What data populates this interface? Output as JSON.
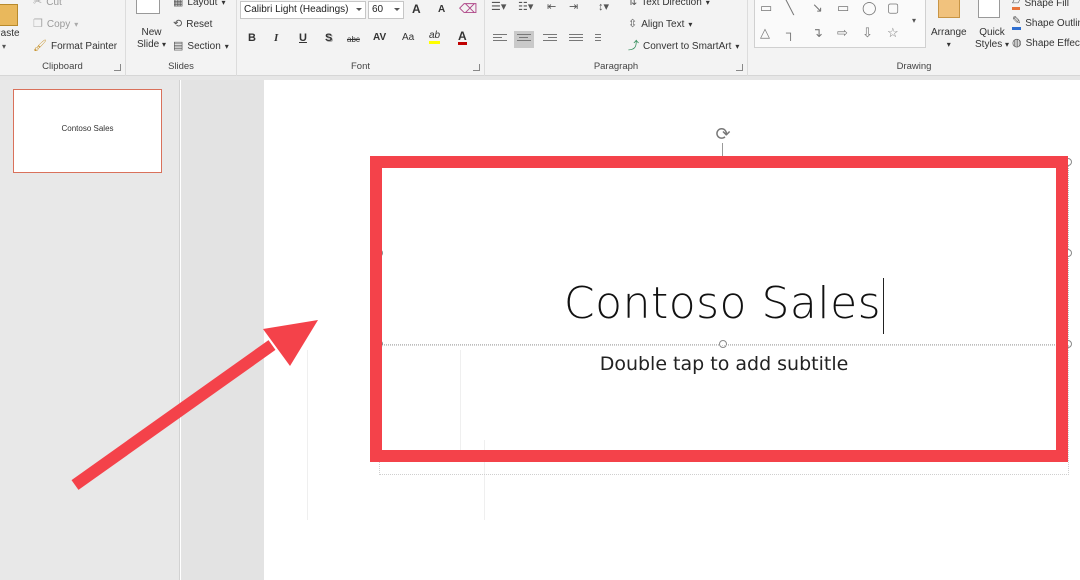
{
  "ribbon": {
    "clipboard": {
      "label": "Clipboard",
      "paste": "Paste",
      "cut": "Cut",
      "copy": "Copy",
      "format_painter": "Format Painter"
    },
    "slides": {
      "label": "Slides",
      "new_slide_line1": "New",
      "new_slide_line2": "Slide",
      "layout": "Layout",
      "reset": "Reset",
      "section": "Section"
    },
    "font": {
      "label": "Font",
      "font_name": "Calibri Light (Headings)",
      "font_size": "60",
      "bold": "B",
      "italic": "I",
      "underline": "U",
      "shadow": "S",
      "strikethrough": "abc",
      "char_spacing": "AV",
      "change_case": "Aa",
      "grow": "A",
      "shrink": "A",
      "highlight": "ab",
      "font_color": "A"
    },
    "paragraph": {
      "label": "Paragraph",
      "text_direction": "Text Direction",
      "align_text": "Align Text",
      "convert_smartart": "Convert to SmartArt"
    },
    "drawing": {
      "label": "Drawing",
      "arrange": "Arrange",
      "quick_styles_line1": "Quick",
      "quick_styles_line2": "Styles",
      "shape_fill": "Shape Fill",
      "shape_outline": "Shape Outline",
      "shape_effects": "Shape Effects"
    }
  },
  "thumbnail": {
    "slide_title": "Contoso Sales"
  },
  "slide": {
    "title": "Contoso Sales",
    "subtitle_placeholder": "Double tap to add subtitle"
  },
  "colors": {
    "annotation_red": "#f4424a",
    "thumbnail_border": "#d9715b",
    "ribbon_bg": "#f3f3f3",
    "font_color_swatch": "#c00000",
    "highlight_swatch": "#ffff00"
  },
  "icons": [
    "paste-icon",
    "cut-icon",
    "copy-icon",
    "format-painter-icon",
    "new-slide-icon",
    "layout-icon",
    "reset-icon",
    "section-icon",
    "rotate-icon",
    "arrow-annotation"
  ]
}
